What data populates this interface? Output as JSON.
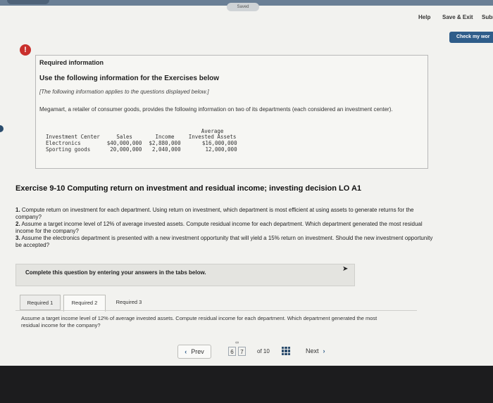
{
  "header": {
    "saved_label": "Saved",
    "help_label": "Help",
    "save_exit_label": "Save & Exit",
    "submit_label": "Subm",
    "check_label": "Check my wor"
  },
  "info": {
    "title": "Required information",
    "subtitle": "Use the following information for the Exercises below",
    "note": "[The following information applies to the questions displayed below.]",
    "description": "Megamart, a retailer of consumer goods, provides the following information on two of its departments (each considered an investment center).",
    "table": {
      "headers": [
        "Investment Center",
        "Sales",
        "Income",
        "Average Invested Assets"
      ],
      "rows": [
        [
          "Electronics",
          "$40,000,000",
          "$2,880,000",
          "$16,000,000"
        ],
        [
          "Sporting goods",
          "20,000,000",
          "2,040,000",
          "12,000,000"
        ]
      ]
    }
  },
  "exercise": {
    "title": "Exercise 9-10 Computing return on investment and residual income; investing decision LO A1",
    "q1_num": "1.",
    "q1": "Compute return on investment for each department. Using return on investment, which department is most efficient at using assets to generate returns for the company?",
    "q2_num": "2.",
    "q2": "Assume a target income level of 12% of average invested assets. Compute residual income for each department. Which department generated the most residual income for the company?",
    "q3_num": "3.",
    "q3": "Assume the electronics department is presented with a new investment opportunity that will yield a 15% return on investment. Should the new investment opportunity be accepted?"
  },
  "complete_text": "Complete this question by entering your answers in the tabs below.",
  "tabs": [
    {
      "label": "Required 1"
    },
    {
      "label": "Required 2"
    },
    {
      "label": "Required 3"
    }
  ],
  "requirement_text": "Assume a target income level of 12% of average invested assets. Compute residual income for each department. Which department generated the most residual income for the company?",
  "pager": {
    "prev_label": "Prev",
    "page_a": "6",
    "page_b": "7",
    "of_text": "of 10",
    "next_label": "Next"
  }
}
